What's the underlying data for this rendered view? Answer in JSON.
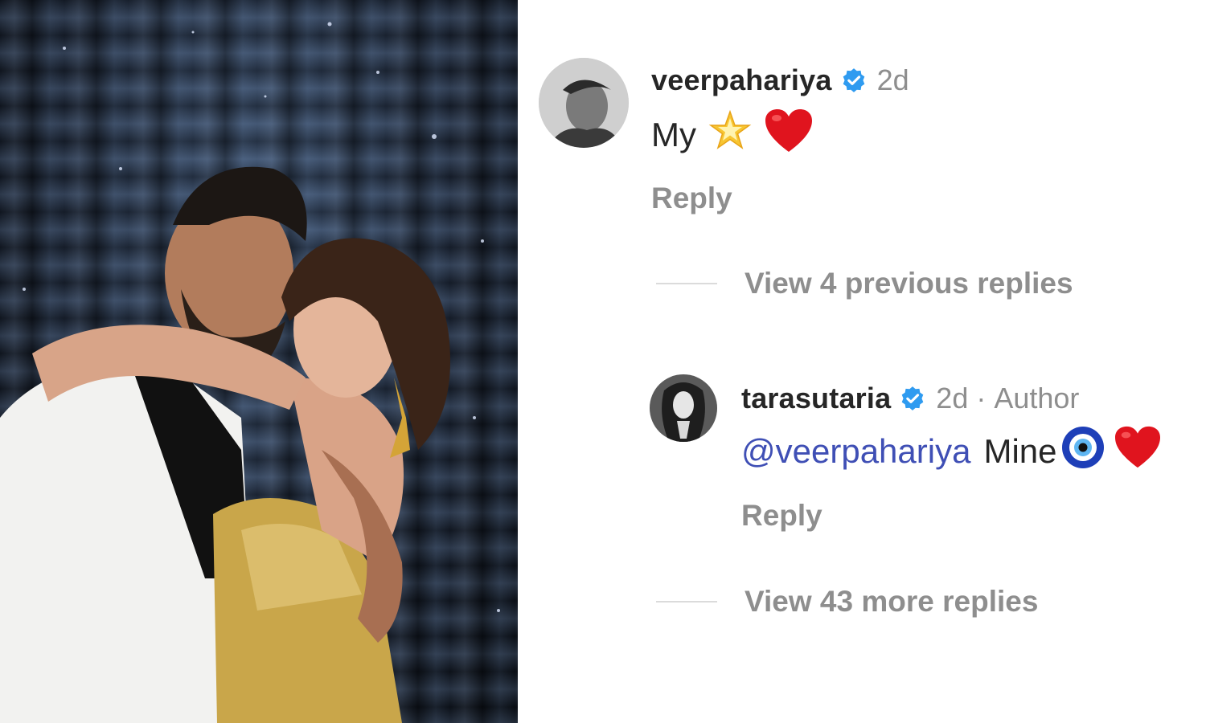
{
  "photo": {
    "description_icon": "couple-photo",
    "background_color": "#1d2738"
  },
  "comments": [
    {
      "username": "veerpahariya",
      "verified": true,
      "time": "2d",
      "text": "My",
      "emojis": [
        "glowing-star-icon",
        "red-heart-icon"
      ],
      "reply_label": "Reply"
    },
    {
      "username": "tarasutaria",
      "verified": true,
      "time": "2d",
      "separator": "·",
      "author_badge": "Author",
      "mention": "@veerpahariya",
      "text": "Mine",
      "emojis": [
        "nazar-amulet-icon",
        "red-heart-icon"
      ],
      "reply_label": "Reply"
    }
  ],
  "view_previous": "View 4 previous replies",
  "view_more": "View 43 more replies",
  "colors": {
    "username": "#262626",
    "meta": "#8e8e8e",
    "mention": "#3f4fb5",
    "verified": "#2f9bf0",
    "heart": "#e0141e"
  }
}
